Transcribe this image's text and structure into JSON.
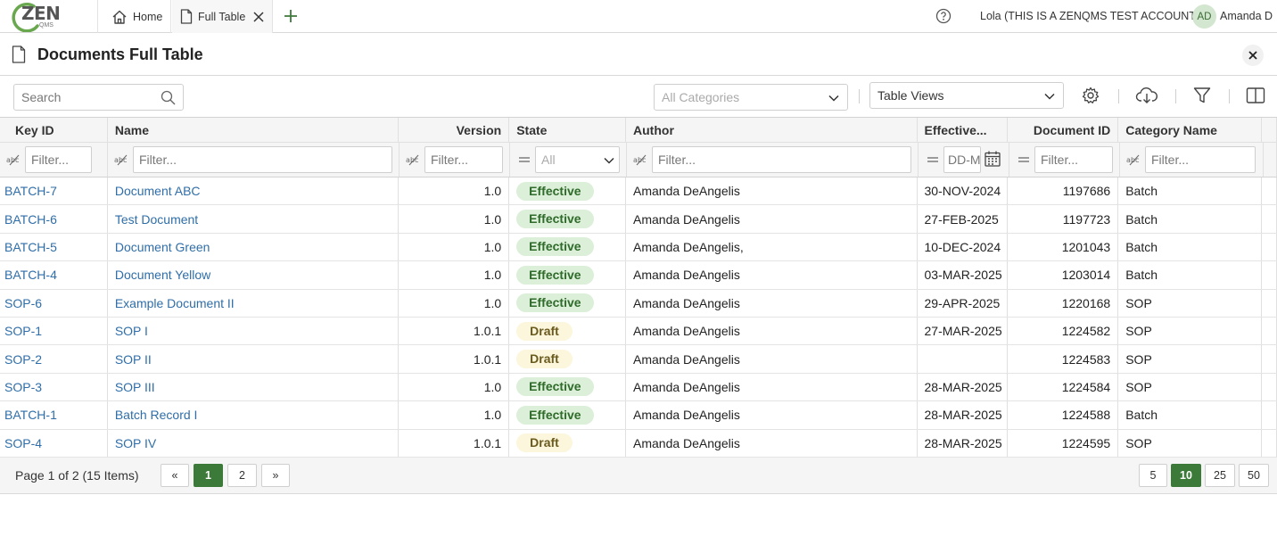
{
  "topbar": {
    "logo_text": "ZEN",
    "logo_sub": "QMS",
    "tabs": [
      {
        "label": "Home"
      },
      {
        "label": "Full Table"
      }
    ],
    "account": "Lola (THIS IS A ZENQMS TEST ACCOUNT)",
    "avatar_initials": "AD",
    "user_name": "Amanda D"
  },
  "page": {
    "title": "Documents Full Table"
  },
  "toolbar": {
    "search_placeholder": "Search",
    "categories_placeholder": "All Categories",
    "table_views_label": "Table Views"
  },
  "table": {
    "columns": [
      "Key ID",
      "Name",
      "Version",
      "State",
      "Author",
      "Effective...",
      "Document ID",
      "Category Name"
    ],
    "filter_placeholder": "Filter...",
    "state_filter_value": "All",
    "date_filter_placeholder": "DD-MMM-YYYY",
    "rows": [
      {
        "key": "BATCH-7",
        "name": "Document ABC",
        "version": "1.0",
        "state": "Effective",
        "author": "Amanda DeAngelis",
        "effective": "30-NOV-2024",
        "doc_id": "1197686",
        "category": "Batch"
      },
      {
        "key": "BATCH-6",
        "name": "Test Document",
        "version": "1.0",
        "state": "Effective",
        "author": "Amanda DeAngelis",
        "effective": "27-FEB-2025",
        "doc_id": "1197723",
        "category": "Batch"
      },
      {
        "key": "BATCH-5",
        "name": "Document Green",
        "version": "1.0",
        "state": "Effective",
        "author": "Amanda DeAngelis,",
        "effective": "10-DEC-2024",
        "doc_id": "1201043",
        "category": "Batch"
      },
      {
        "key": "BATCH-4",
        "name": "Document Yellow",
        "version": "1.0",
        "state": "Effective",
        "author": "Amanda DeAngelis",
        "effective": "03-MAR-2025",
        "doc_id": "1203014",
        "category": "Batch"
      },
      {
        "key": "SOP-6",
        "name": "Example Document II",
        "version": "1.0",
        "state": "Effective",
        "author": "Amanda DeAngelis",
        "effective": "29-APR-2025",
        "doc_id": "1220168",
        "category": "SOP"
      },
      {
        "key": "SOP-1",
        "name": "SOP I",
        "version": "1.0.1",
        "state": "Draft",
        "author": "Amanda DeAngelis",
        "effective": "27-MAR-2025",
        "doc_id": "1224582",
        "category": "SOP"
      },
      {
        "key": "SOP-2",
        "name": "SOP II",
        "version": "1.0.1",
        "state": "Draft",
        "author": "Amanda DeAngelis",
        "effective": "",
        "doc_id": "1224583",
        "category": "SOP"
      },
      {
        "key": "SOP-3",
        "name": "SOP III",
        "version": "1.0",
        "state": "Effective",
        "author": "Amanda DeAngelis",
        "effective": "28-MAR-2025",
        "doc_id": "1224584",
        "category": "SOP"
      },
      {
        "key": "BATCH-1",
        "name": "Batch Record I",
        "version": "1.0",
        "state": "Effective",
        "author": "Amanda DeAngelis",
        "effective": "28-MAR-2025",
        "doc_id": "1224588",
        "category": "Batch"
      },
      {
        "key": "SOP-4",
        "name": "SOP IV",
        "version": "1.0.1",
        "state": "Draft",
        "author": "Amanda DeAngelis",
        "effective": "28-MAR-2025",
        "doc_id": "1224595",
        "category": "SOP"
      }
    ]
  },
  "pager": {
    "info": "Page 1 of 2 (15 Items)",
    "first": "«",
    "last": "»",
    "pages": [
      "1",
      "2"
    ],
    "current_page": "1",
    "page_sizes": [
      "5",
      "10",
      "25",
      "50"
    ],
    "current_size": "10"
  },
  "colors": {
    "link": "#2f6ea8",
    "accent_green": "#3c7a3a",
    "effective_bg": "#dcefd9",
    "draft_bg": "#fbf6dc"
  }
}
